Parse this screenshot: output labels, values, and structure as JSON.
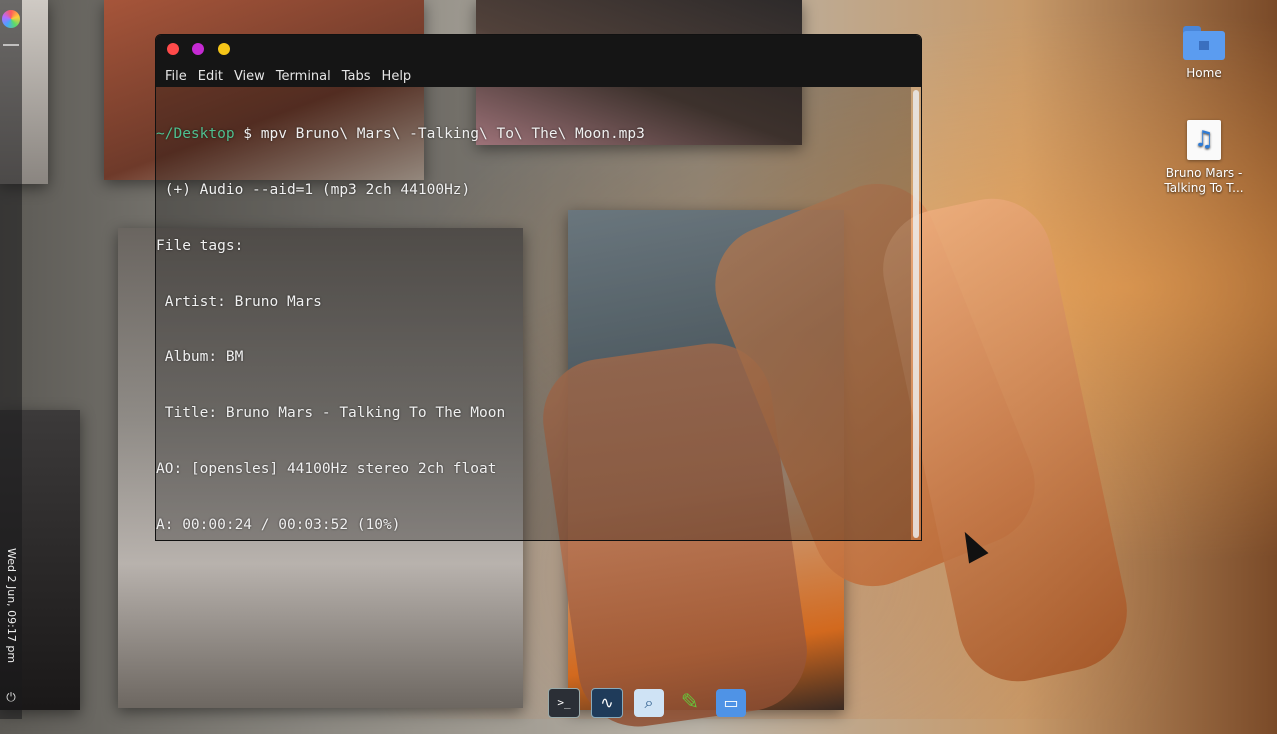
{
  "desktop": {
    "icons": [
      {
        "label": "Home",
        "icon": "home-folder-icon"
      },
      {
        "label": "Bruno Mars -\nTalking To T...",
        "icon": "audio-file-icon"
      }
    ]
  },
  "left_panel": {
    "clock": "Wed 2 Jun, 09:17 pm",
    "launcher_icon": "color-wheel-icon",
    "power_icon": "power-icon"
  },
  "terminal": {
    "menu": [
      "File",
      "Edit",
      "View",
      "Terminal",
      "Tabs",
      "Help"
    ],
    "prompt_path": "~/Desktop",
    "command": " $ mpv Bruno\\ Mars\\ -Talking\\ To\\ The\\ Moon.mp3",
    "output_lines": [
      " (+) Audio --aid=1 (mp3 2ch 44100Hz)",
      "File tags:",
      " Artist: Bruno Mars",
      " Album: BM",
      " Title: Bruno Mars - Talking To The Moon",
      "AO: [opensles] 44100Hz stereo 2ch float",
      "A: 00:00:24 / 00:03:52 (10%)"
    ],
    "colors": {
      "close": "#ff4a4a",
      "minimize": "#c52ad3",
      "maximize": "#f5c518",
      "prompt": "#4fbf8f"
    }
  },
  "dock": {
    "items": [
      {
        "name": "terminal-icon",
        "glyph": ">_"
      },
      {
        "name": "system-monitor-icon",
        "glyph": "∿"
      },
      {
        "name": "search-icon",
        "glyph": "⌕"
      },
      {
        "name": "text-editor-icon",
        "glyph": "✎"
      },
      {
        "name": "files-icon",
        "glyph": "▭"
      }
    ]
  }
}
